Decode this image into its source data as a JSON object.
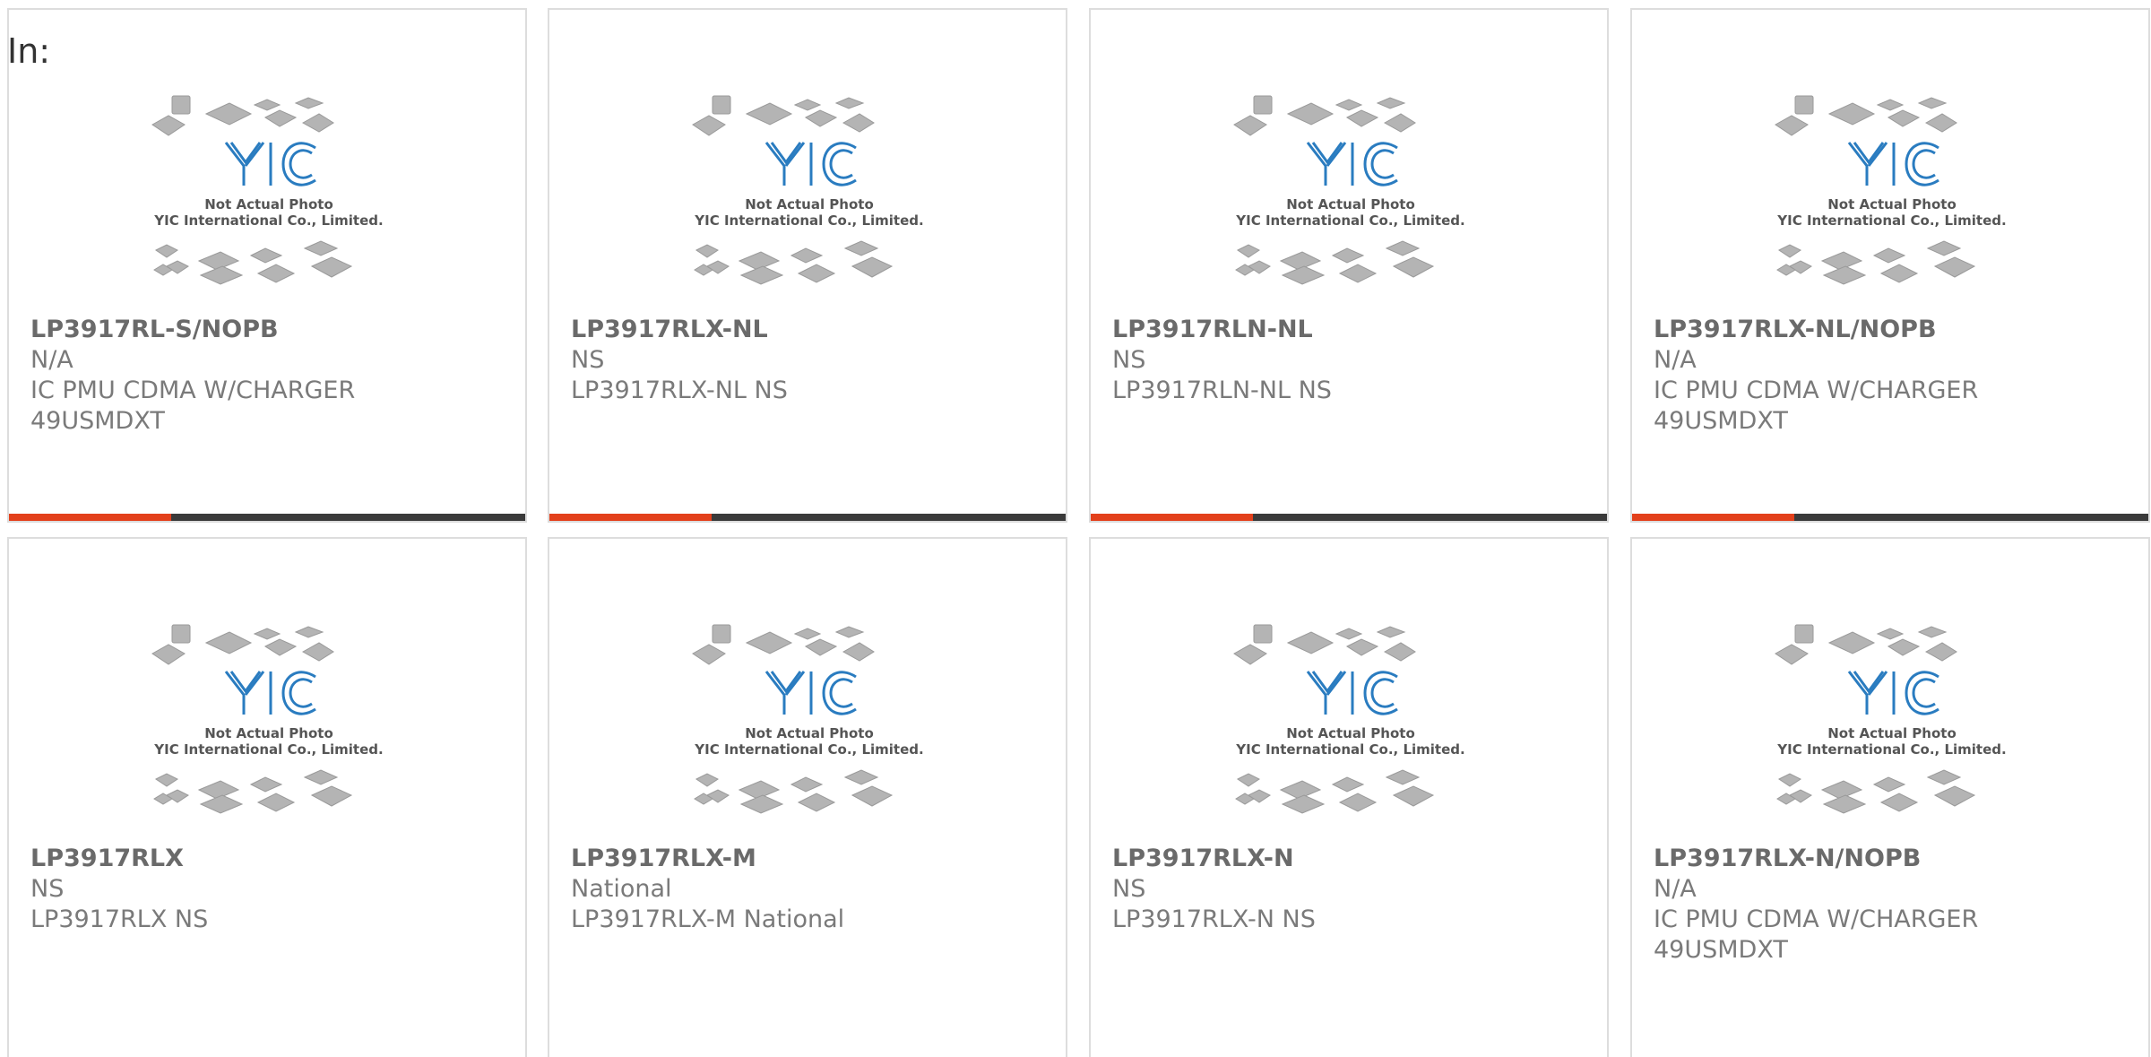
{
  "header": {
    "label": "In:"
  },
  "colors": {
    "accent": "#e3401b",
    "bar": "#3a3a3a",
    "logo": "#2a7cc0"
  },
  "photo_caption": {
    "line1": "Not Actual Photo",
    "line2": "YIC International Co., Limited.",
    "logo_text": "YIC"
  },
  "products": [
    {
      "part": "LP3917RL-S/NOPB",
      "lines": [
        "N/A",
        "IC PMU CDMA W/CHARGER",
        "49USMDXT"
      ]
    },
    {
      "part": "LP3917RLX-NL",
      "lines": [
        "NS",
        "LP3917RLX-NL NS",
        ""
      ]
    },
    {
      "part": "LP3917RLN-NL",
      "lines": [
        "NS",
        "LP3917RLN-NL NS",
        ""
      ]
    },
    {
      "part": "LP3917RLX-NL/NOPB",
      "lines": [
        "N/A",
        "IC PMU CDMA W/CHARGER",
        "49USMDXT"
      ]
    },
    {
      "part": "LP3917RLX",
      "lines": [
        "NS",
        "LP3917RLX NS",
        ""
      ]
    },
    {
      "part": "LP3917RLX-M",
      "lines": [
        "National",
        "LP3917RLX-M National",
        ""
      ]
    },
    {
      "part": "LP3917RLX-N",
      "lines": [
        "NS",
        "LP3917RLX-N NS",
        ""
      ]
    },
    {
      "part": "LP3917RLX-N/NOPB",
      "lines": [
        "N/A",
        "IC PMU CDMA W/CHARGER",
        "49USMDXT"
      ]
    }
  ]
}
